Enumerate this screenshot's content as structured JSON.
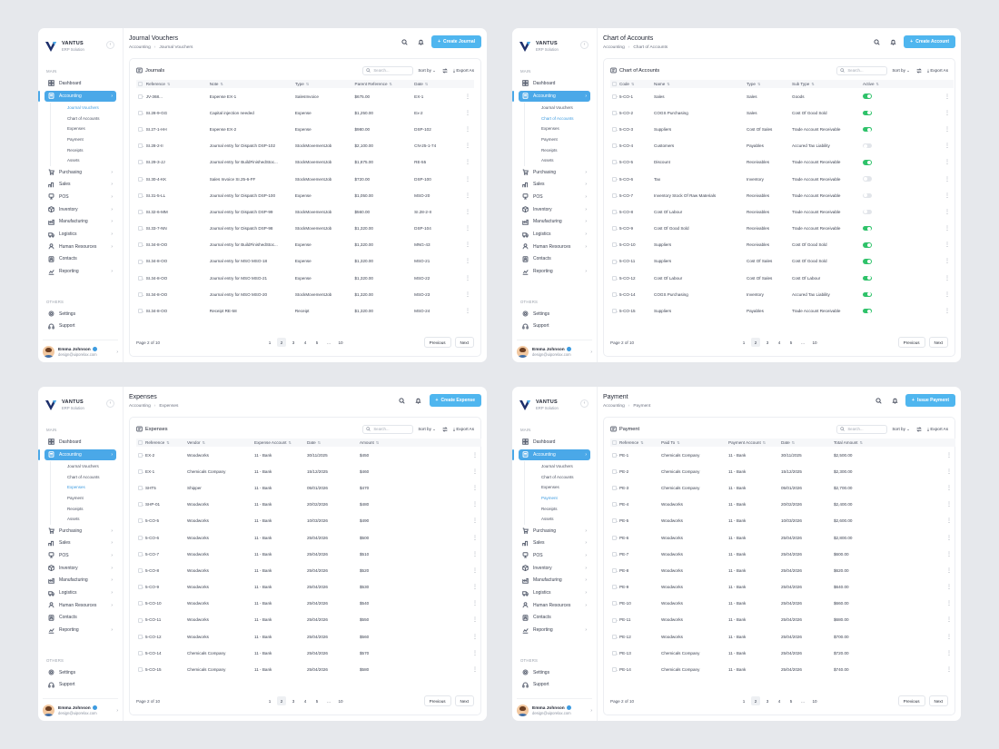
{
  "app": {
    "brand": "VANTUS",
    "brand_sub": "ERP Solution"
  },
  "sidebar": {
    "main_label": "MAIN",
    "items": [
      {
        "key": "dashboard",
        "label": "Dashboard",
        "icon": "dashboard-icon"
      },
      {
        "key": "accounting",
        "label": "Accounting",
        "icon": "accounting-icon",
        "active": true
      },
      {
        "key": "purchasing",
        "label": "Purchasing",
        "icon": "cart-icon"
      },
      {
        "key": "sales",
        "label": "Sales",
        "icon": "sales-icon"
      },
      {
        "key": "pos",
        "label": "POS",
        "icon": "pos-icon"
      },
      {
        "key": "inventory",
        "label": "Inventory",
        "icon": "box-icon"
      },
      {
        "key": "manufacturing",
        "label": "Manufacturing",
        "icon": "factory-icon"
      },
      {
        "key": "logistics",
        "label": "Logistics",
        "icon": "truck-icon"
      },
      {
        "key": "human-resources",
        "label": "Human Resources",
        "icon": "people-icon"
      },
      {
        "key": "contacts",
        "label": "Contacts",
        "icon": "contacts-icon"
      },
      {
        "key": "reporting",
        "label": "Reporting",
        "icon": "report-icon"
      }
    ],
    "sub_items": [
      "Journal Vouchers",
      "Chart of Accounts",
      "Expenses",
      "Payment",
      "Receipts",
      "Assets"
    ],
    "others_label": "OTHERS",
    "others": [
      {
        "key": "settings",
        "label": "Settings",
        "icon": "gear-icon"
      },
      {
        "key": "support",
        "label": "Support",
        "icon": "headset-icon"
      }
    ],
    "user": {
      "name": "Emma Johnson",
      "email": "design@uiporelax.com"
    }
  },
  "common": {
    "search_placeholder": "Search...",
    "sort_label": "Sort by",
    "export_label": "Export As",
    "page_info": "Page 2 of 10",
    "pages": [
      "1",
      "2",
      "3",
      "4",
      "5",
      "...",
      "10"
    ],
    "prev": "Previous",
    "next": "Next",
    "parent_crumb": "Accounting"
  },
  "panels": [
    {
      "key": "journals",
      "title": "Journal Vouchers",
      "crumb": "Journal Vouchers",
      "cta": "Create Journal",
      "card_title": "Journals",
      "active_sub": 0,
      "columns": [
        "Reference",
        "Note",
        "Type",
        "Parent Reference",
        "Date"
      ],
      "rows": [
        [
          "JV-368...",
          "Expense EX-1",
          "SalesInvoice",
          "$675.00",
          "EX-1"
        ],
        [
          "SI.28-9-GG",
          "Capital injection needed",
          "Expense",
          "$1,250.00",
          "Ex-2"
        ],
        [
          "SI.27-1-HH",
          "Expense EX-2",
          "Expense",
          "$980.00",
          "DSP-102"
        ],
        [
          "SI.28-2-II",
          "Journal entry for Dispatch DSP-102",
          "StockMovementJob",
          "$2,100.00",
          "CN-25-1-74"
        ],
        [
          "SI.29-3-JJ",
          "Journal entry for BuildFinishedStoc...",
          "StockMovementJob",
          "$1,875.00",
          "RE-55"
        ],
        [
          "SI.30-4-KK",
          "Sales Invoice SI.25-6-FF",
          "StockMovementJob",
          "$720.00",
          "DSP-100"
        ],
        [
          "SI.31-5-LL",
          "Journal entry for Dispatch DSP-100",
          "Expense",
          "$1,050.00",
          "MSO-20"
        ],
        [
          "SI.32-6-MM",
          "Journal entry for Dispatch DSP-99",
          "StockMovementJob",
          "$560.00",
          "SI.28-2-II"
        ],
        [
          "SI.33-7-NN",
          "Journal entry for Dispatch DSP-98",
          "StockMovementJob",
          "$1,320.00",
          "DSP-104"
        ],
        [
          "SI.34-8-OO",
          "Journal entry for BuildFinishedStoc...",
          "Expense",
          "$1,320.00",
          "MNG-43"
        ],
        [
          "SI.34-8-OO",
          "Journal entry for MSO MSO-18",
          "Expense",
          "$1,320.00",
          "MSO-21"
        ],
        [
          "SI.34-8-OO",
          "Journal entry for MSO MSO-21",
          "Expense",
          "$1,320.00",
          "MSO-22"
        ],
        [
          "SI.34-8-OO",
          "Journal entry for MSO MSO-20",
          "StockMovementJob",
          "$1,320.00",
          "MSO-23"
        ],
        [
          "SI.34-8-OO",
          "Receipt RE-58",
          "Receipt",
          "$1,320.00",
          "MSO-24"
        ]
      ]
    },
    {
      "key": "accounts",
      "title": "Chart of Accounts",
      "crumb": "Chart of Accounts",
      "cta": "Create Account",
      "card_title": "Chart of Accounts",
      "active_sub": 1,
      "columns": [
        "Code",
        "Name",
        "Type",
        "Sub Type",
        "Active"
      ],
      "rows": [
        [
          "5-CO-1",
          "Sales",
          "Sales",
          "Goods",
          "on"
        ],
        [
          "5-CO-2",
          "COGS Purchasing",
          "Sales",
          "Cost Of Good Sold",
          "on"
        ],
        [
          "5-CO-3",
          "Suppliers",
          "Cost Of Sales",
          "Trade Account Receivable",
          "on"
        ],
        [
          "5-CO-4",
          "Customers",
          "Payables",
          "Accured Tax Liability",
          "off"
        ],
        [
          "5-CO-5",
          "Discount",
          "Receivables",
          "Trade Account Receivable",
          "on"
        ],
        [
          "5-CO-6",
          "Tax",
          "Inventory",
          "Trade Account Receivable",
          "off"
        ],
        [
          "5-CO-7",
          "Inventory Stock Of Raw Materials",
          "Receivables",
          "Trade Account Receivable",
          "off"
        ],
        [
          "5-CO-8",
          "Cost Of Labour",
          "Receivables",
          "Trade Account Receivable",
          "off"
        ],
        [
          "5-CO-9",
          "Cost Of Good Sold",
          "Receivables",
          "Trade Account Receivable",
          "on"
        ],
        [
          "5-CO-10",
          "Suppliers",
          "Receivables",
          "Cost Of Good Sold",
          "on"
        ],
        [
          "5-CO-11",
          "Suppliers",
          "Cost Of Sales",
          "Cost Of Good Sold",
          "on"
        ],
        [
          "5-CO-12",
          "Cost Of Labour",
          "Cost Of Sales",
          "Cost Of Labour",
          "on"
        ],
        [
          "5-CO-14",
          "COGS Purchasing",
          "Inventory",
          "Accured Tax Liability",
          "on"
        ],
        [
          "5-CO-15",
          "Suppliers",
          "Payables",
          "Trade Account Receivable",
          "on"
        ]
      ]
    },
    {
      "key": "expenses",
      "title": "Expenses",
      "crumb": "Expenses",
      "cta": "Create Expense",
      "card_title": "Expenses",
      "active_sub": 2,
      "columns": [
        "Reference",
        "Vendor",
        "Expense Account",
        "Date",
        "Amount"
      ],
      "rows": [
        [
          "EX-2",
          "Woodworks",
          "11 - Bank",
          "30/11/2025",
          "$450"
        ],
        [
          "EX-1",
          "Chemicals Company",
          "11 - Bank",
          "15/12/2025",
          "$460"
        ],
        [
          "SHT5",
          "Shipper",
          "11 - Bank",
          "05/01/2026",
          "$470"
        ],
        [
          "SHP-01",
          "Woodworks",
          "11 - Bank",
          "20/02/2026",
          "$480"
        ],
        [
          "5-CO-5",
          "Woodworks",
          "11 - Bank",
          "10/03/2026",
          "$490"
        ],
        [
          "5-CO-6",
          "Woodworks",
          "11 - Bank",
          "25/04/2026",
          "$500"
        ],
        [
          "5-CO-7",
          "Woodworks",
          "11 - Bank",
          "25/04/2026",
          "$510"
        ],
        [
          "5-CO-8",
          "Woodworks",
          "11 - Bank",
          "25/04/2026",
          "$520"
        ],
        [
          "5-CO-9",
          "Woodworks",
          "11 - Bank",
          "25/04/2026",
          "$530"
        ],
        [
          "5-CO-10",
          "Woodworks",
          "11 - Bank",
          "25/04/2026",
          "$540"
        ],
        [
          "5-CO-11",
          "Woodworks",
          "11 - Bank",
          "25/04/2026",
          "$550"
        ],
        [
          "5-CO-12",
          "Woodworks",
          "11 - Bank",
          "25/04/2026",
          "$560"
        ],
        [
          "5-CO-14",
          "Chemicals Company",
          "11 - Bank",
          "25/04/2026",
          "$570"
        ],
        [
          "5-CO-15",
          "Chemicals Company",
          "11 - Bank",
          "25/04/2026",
          "$580"
        ]
      ]
    },
    {
      "key": "payment",
      "title": "Payment",
      "crumb": "Payment",
      "cta": "Issue Payment",
      "card_title": "Payment",
      "active_sub": 3,
      "columns": [
        "Reference",
        "Paid To",
        "Payment Account",
        "Date",
        "Total Amount"
      ],
      "rows": [
        [
          "PE-1",
          "Chemicals Company",
          "11 - Bank",
          "30/11/2025",
          "$2,500.00"
        ],
        [
          "PE-2",
          "Chemicals Company",
          "11 - Bank",
          "15/12/2025",
          "$2,300.00"
        ],
        [
          "PE-3",
          "Chemicals Company",
          "11 - Bank",
          "05/01/2026",
          "$2,700.00"
        ],
        [
          "PE-4",
          "Woodworks",
          "11 - Bank",
          "20/02/2026",
          "$2,400.00"
        ],
        [
          "PE-5",
          "Woodworks",
          "11 - Bank",
          "10/03/2026",
          "$2,600.00"
        ],
        [
          "PE-6",
          "Woodworks",
          "11 - Bank",
          "25/04/2026",
          "$2,800.00"
        ],
        [
          "PE-7",
          "Woodworks",
          "11 - Bank",
          "25/04/2026",
          "$600.00"
        ],
        [
          "PE-8",
          "Woodworks",
          "11 - Bank",
          "25/04/2026",
          "$620.00"
        ],
        [
          "PE-9",
          "Woodworks",
          "11 - Bank",
          "25/04/2026",
          "$640.00"
        ],
        [
          "PE-10",
          "Woodworks",
          "11 - Bank",
          "25/04/2026",
          "$660.00"
        ],
        [
          "PE-11",
          "Woodworks",
          "11 - Bank",
          "25/04/2026",
          "$680.00"
        ],
        [
          "PE-12",
          "Woodworks",
          "11 - Bank",
          "25/04/2026",
          "$700.00"
        ],
        [
          "PE-13",
          "Chemicals Company",
          "11 - Bank",
          "25/04/2026",
          "$720.00"
        ],
        [
          "PE-14",
          "Chemicals Company",
          "11 - Bank",
          "25/04/2026",
          "$740.00"
        ]
      ]
    }
  ]
}
